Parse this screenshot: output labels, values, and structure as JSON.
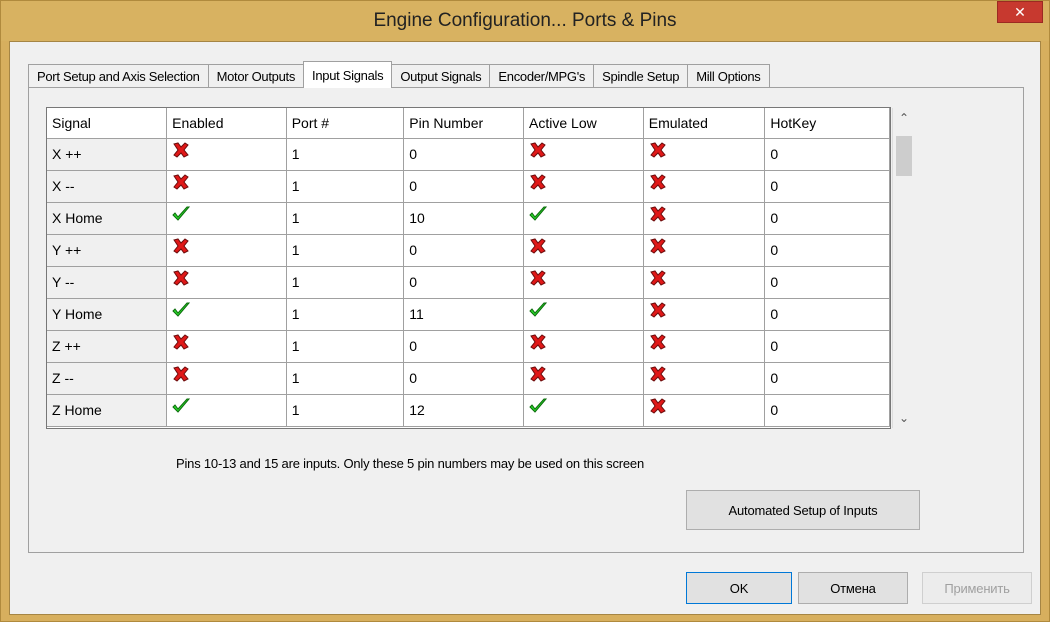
{
  "window": {
    "title": "Engine Configuration... Ports & Pins",
    "close_label": "✕"
  },
  "tabs": [
    {
      "label": "Port Setup and Axis Selection",
      "active": false
    },
    {
      "label": "Motor Outputs",
      "active": false
    },
    {
      "label": "Input Signals",
      "active": true
    },
    {
      "label": "Output Signals",
      "active": false
    },
    {
      "label": "Encoder/MPG's",
      "active": false
    },
    {
      "label": "Spindle Setup",
      "active": false
    },
    {
      "label": "Mill Options",
      "active": false
    }
  ],
  "grid": {
    "columns": [
      "Signal",
      "Enabled",
      "Port #",
      "Pin Number",
      "Active Low",
      "Emulated",
      "HotKey"
    ],
    "rows": [
      {
        "signal": "X ++",
        "enabled": false,
        "port": "1",
        "pin": "0",
        "active_low": false,
        "emulated": false,
        "hotkey": "0"
      },
      {
        "signal": "X --",
        "enabled": false,
        "port": "1",
        "pin": "0",
        "active_low": false,
        "emulated": false,
        "hotkey": "0"
      },
      {
        "signal": "X Home",
        "enabled": true,
        "port": "1",
        "pin": "10",
        "active_low": true,
        "emulated": false,
        "hotkey": "0"
      },
      {
        "signal": "Y ++",
        "enabled": false,
        "port": "1",
        "pin": "0",
        "active_low": false,
        "emulated": false,
        "hotkey": "0"
      },
      {
        "signal": "Y --",
        "enabled": false,
        "port": "1",
        "pin": "0",
        "active_low": false,
        "emulated": false,
        "hotkey": "0"
      },
      {
        "signal": "Y Home",
        "enabled": true,
        "port": "1",
        "pin": "11",
        "active_low": true,
        "emulated": false,
        "hotkey": "0"
      },
      {
        "signal": "Z ++",
        "enabled": false,
        "port": "1",
        "pin": "0",
        "active_low": false,
        "emulated": false,
        "hotkey": "0"
      },
      {
        "signal": "Z --",
        "enabled": false,
        "port": "1",
        "pin": "0",
        "active_low": false,
        "emulated": false,
        "hotkey": "0"
      },
      {
        "signal": "Z Home",
        "enabled": true,
        "port": "1",
        "pin": "12",
        "active_low": true,
        "emulated": false,
        "hotkey": "0"
      }
    ]
  },
  "note": "Pins 10-13 and 15 are inputs. Only these 5 pin numbers may be used on this screen",
  "buttons": {
    "auto_setup": "Automated Setup of Inputs",
    "ok": "OK",
    "cancel": "Отмена",
    "apply": "Применить"
  },
  "icons": {
    "check": "green-check-icon",
    "cross": "red-x-icon"
  },
  "colors": {
    "check": "#2bd62b",
    "cross": "#e01818",
    "title_bar": "#d8b261",
    "close": "#c7392f"
  }
}
